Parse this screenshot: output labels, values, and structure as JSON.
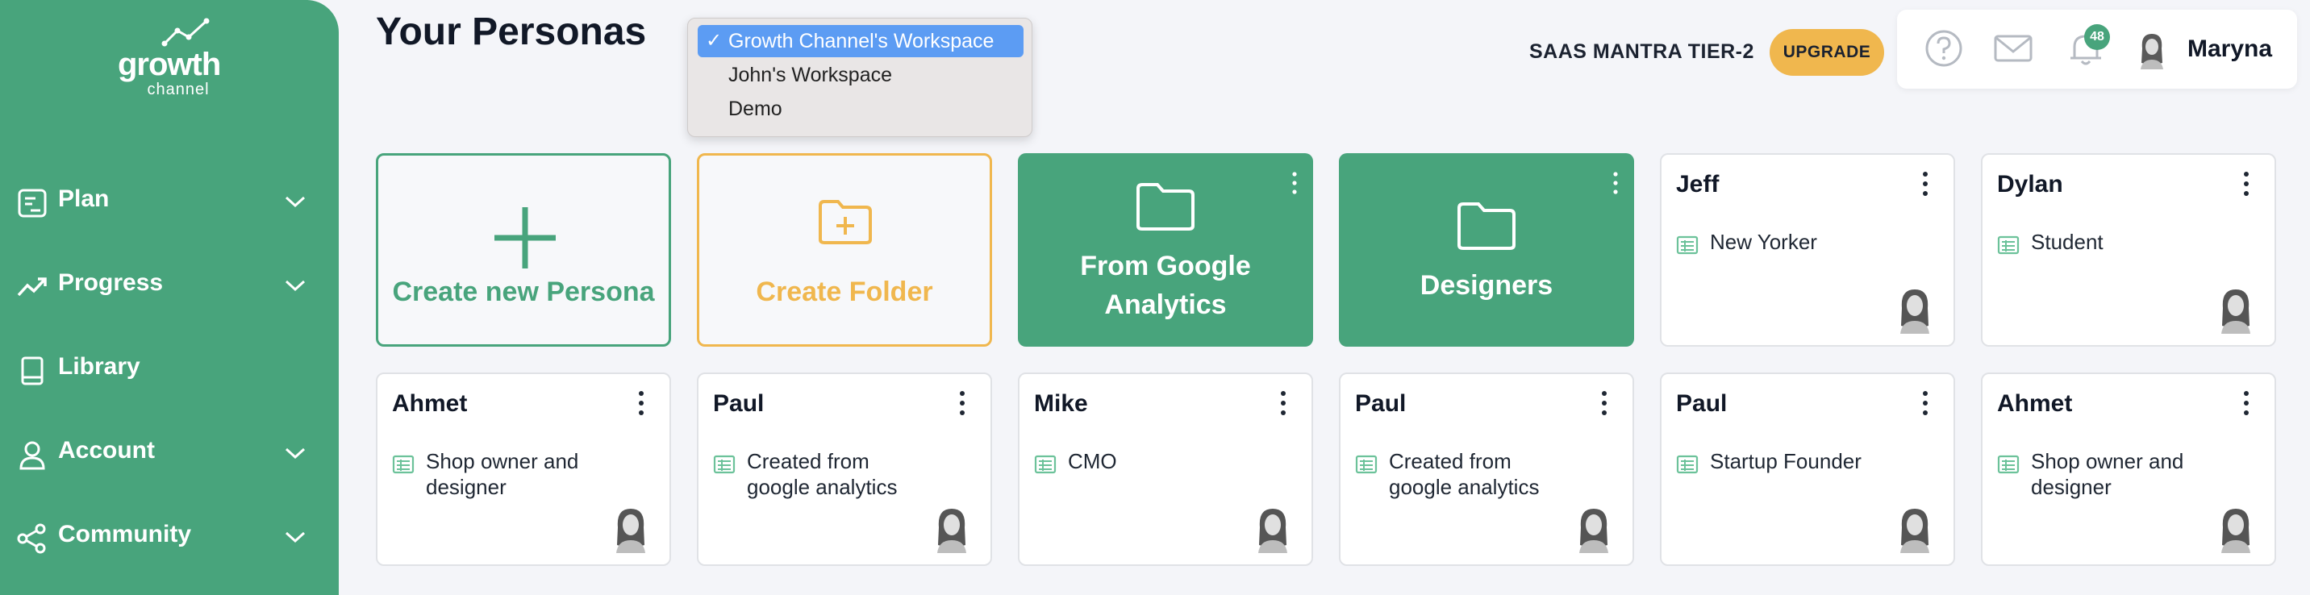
{
  "sidebar": {
    "logo": {
      "word": "growth",
      "sub": "channel"
    },
    "items": [
      {
        "label": "Plan",
        "icon": "plan-icon",
        "has_chevron": true
      },
      {
        "label": "Progress",
        "icon": "progress-icon",
        "has_chevron": true
      },
      {
        "label": "Library",
        "icon": "book-icon",
        "has_chevron": false
      },
      {
        "label": "Account",
        "icon": "user-icon",
        "has_chevron": true
      },
      {
        "label": "Community",
        "icon": "share-icon",
        "has_chevron": true
      }
    ]
  },
  "header": {
    "title": "Your Personas",
    "workspace_options": [
      "Growth Channel's Workspace",
      "John's Workspace",
      "Demo"
    ],
    "selected_workspace": "Growth Channel's Workspace",
    "tier_label": "SAAS MANTRA TIER-2",
    "upgrade_label": "UPGRADE",
    "notification_count": "48",
    "user_name": "Maryna"
  },
  "actions": {
    "create_persona": "Create new Persona",
    "create_folder": "Create Folder"
  },
  "folders": [
    {
      "label": "From Google Analytics",
      "lines": [
        "From Google",
        "Analytics"
      ]
    },
    {
      "label": "Designers",
      "lines": [
        "Designers"
      ]
    }
  ],
  "personas": [
    {
      "name": "Jeff",
      "description": "New Yorker"
    },
    {
      "name": "Dylan",
      "description": "Student"
    },
    {
      "name": "Ahmet",
      "description": "Shop owner and designer"
    },
    {
      "name": "Paul",
      "description": "Created from google analytics"
    },
    {
      "name": "Mike",
      "description": "CMO"
    },
    {
      "name": "Paul",
      "description": "Created from google analytics"
    },
    {
      "name": "Paul",
      "description": "Startup Founder"
    },
    {
      "name": "Ahmet",
      "description": "Shop owner and designer"
    }
  ],
  "colors": {
    "brand": "#48a47c",
    "accent": "#f0b74e",
    "background": "#f4f5f9"
  }
}
